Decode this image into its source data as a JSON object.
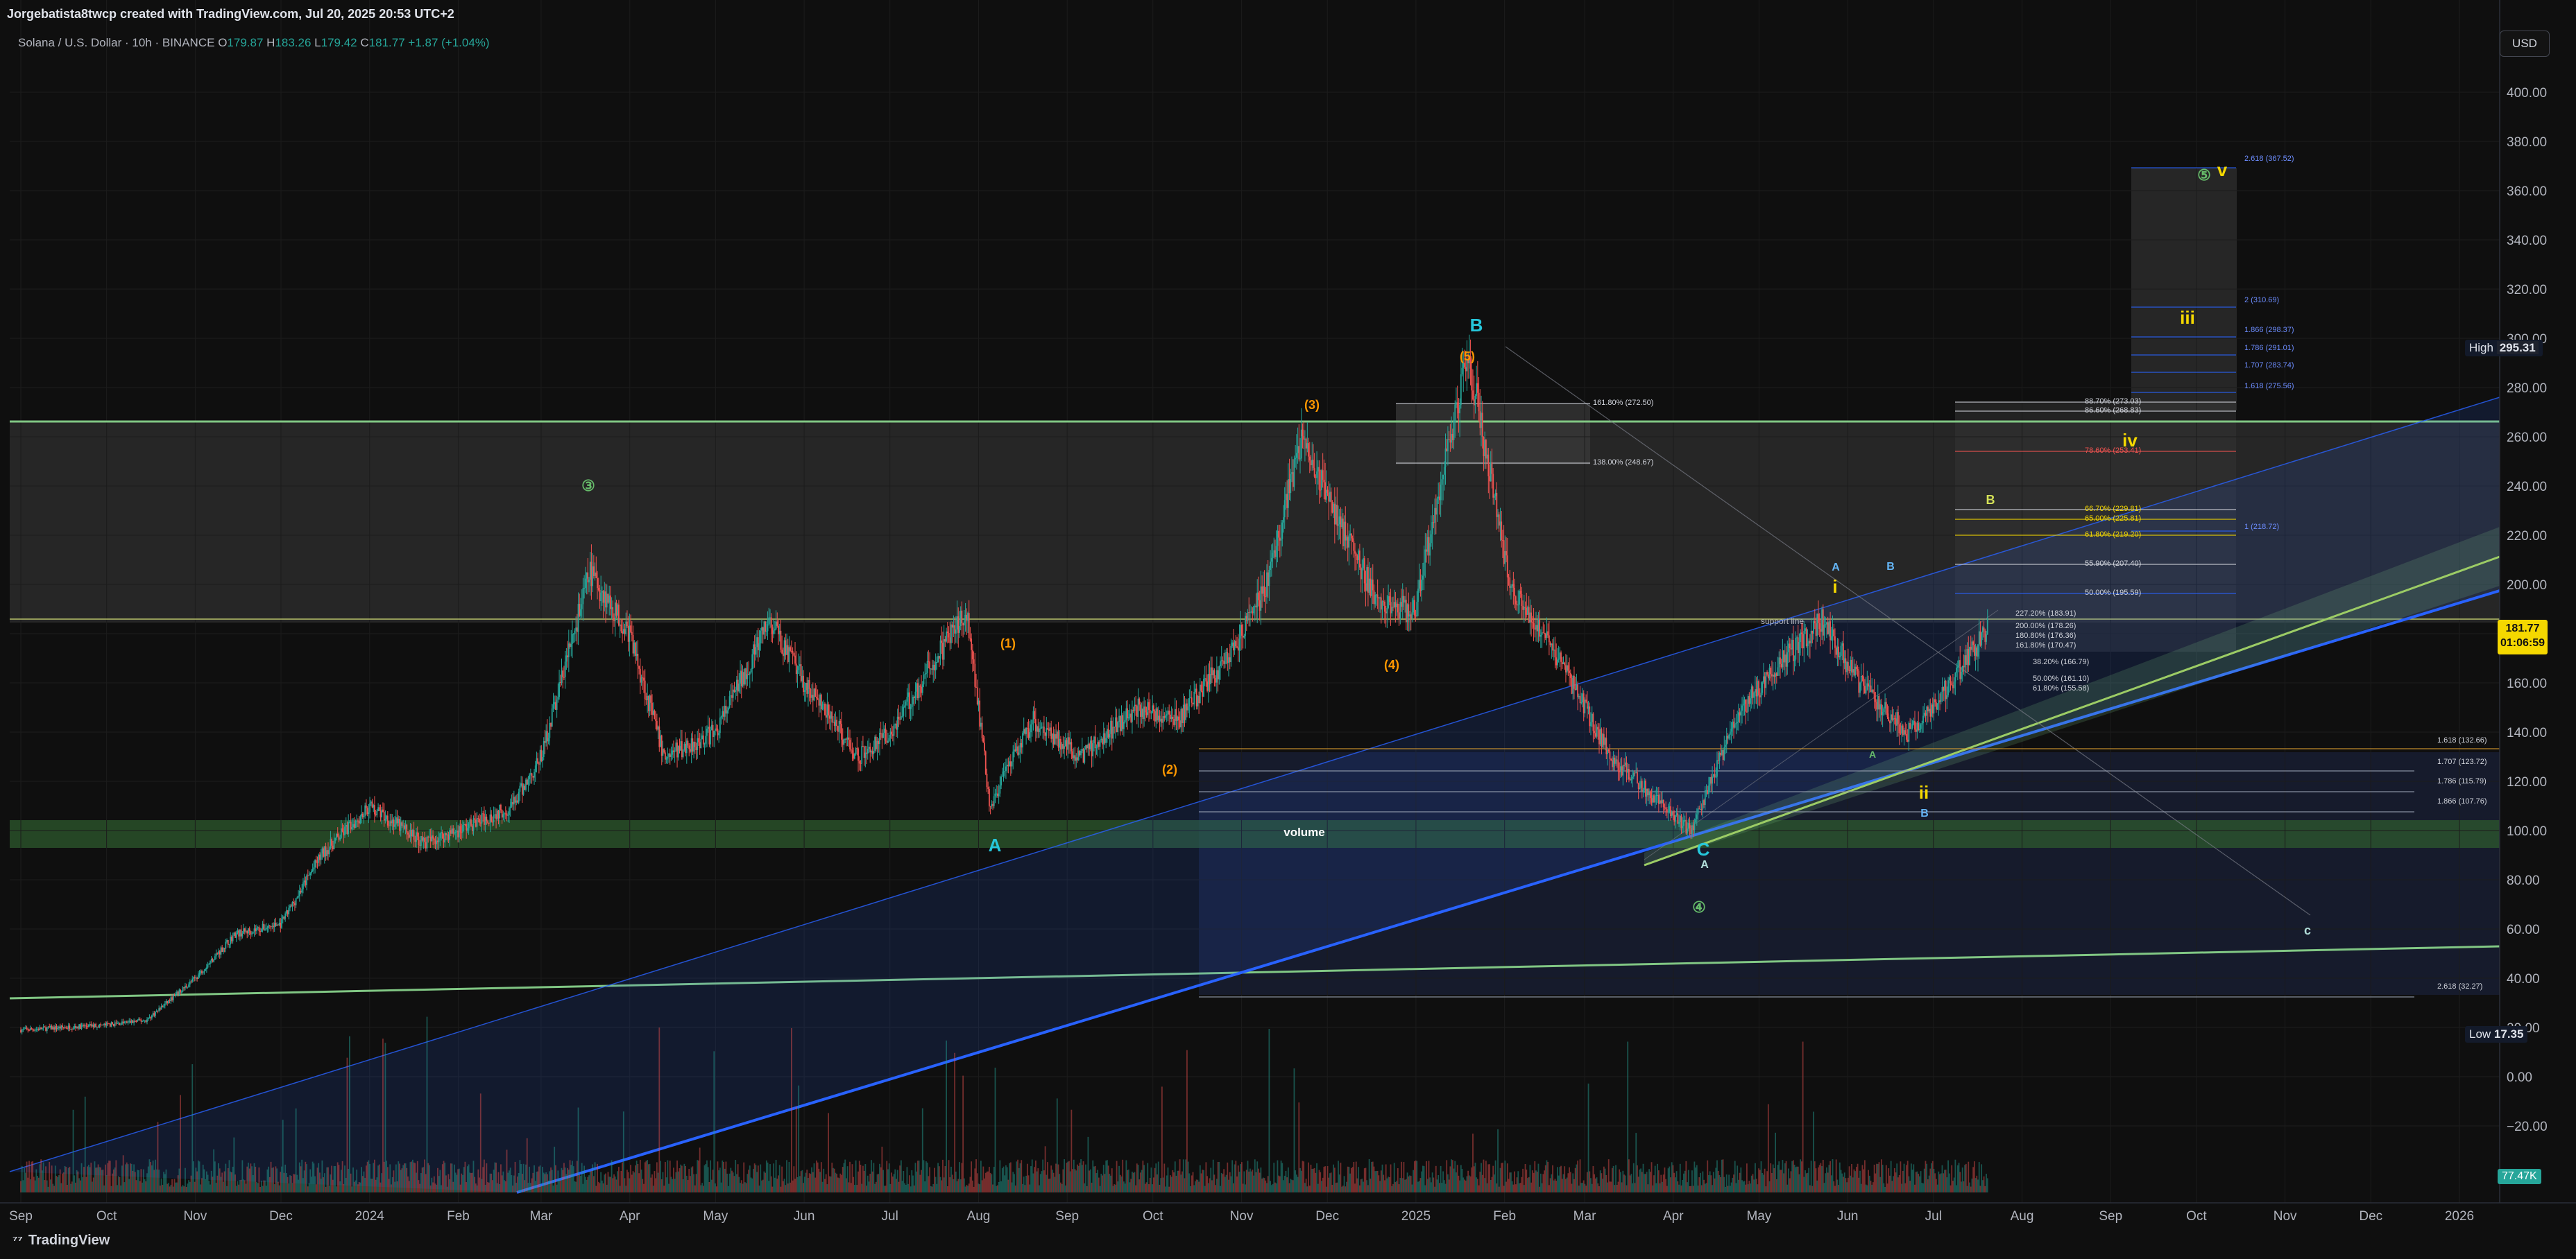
{
  "header": {
    "attribution": "Jorgebatista8twcp created with TradingView.com, Jul 20, 2025 20:53 UTC+2",
    "symbol_line": "Solana / U.S. Dollar · 10h · BINANCE",
    "open_label": "O",
    "open": "179.87",
    "high_label": "H",
    "high": "183.26",
    "low_label": "L",
    "low": "179.42",
    "close_label": "C",
    "close": "181.77",
    "change": "+1.87 (+1.04%)",
    "currency_button": "USD"
  },
  "price_tags": {
    "high_label": "High",
    "high_value": "295.31",
    "low_label": "Low",
    "low_value": "17.35",
    "last_price": "181.77",
    "countdown": "01:06:59",
    "volume_value": "77.47K"
  },
  "footer": {
    "brand": "TradingView"
  },
  "colors": {
    "up": "#26a69a",
    "down": "#ef5350",
    "channel_blue": "#2962ff",
    "channel_green": "#81c784",
    "fib_yellow": "#f5d800",
    "wave_orange": "#ff9800",
    "wave_cyan": "#26c6da"
  },
  "chart_data": {
    "type": "line",
    "title": "Solana / U.S. Dollar · 10h · BINANCE",
    "ylim": [
      -40,
      420
    ],
    "y_ticks": [
      400,
      380,
      360,
      340,
      320,
      300,
      280,
      260,
      240,
      220,
      200,
      180,
      160,
      140,
      120,
      100,
      80,
      60,
      40,
      20,
      "0.00",
      "−20.00"
    ],
    "x_ticks": [
      "Sep",
      "Oct",
      "Nov",
      "Dec",
      "2024",
      "Feb",
      "Mar",
      "Apr",
      "May",
      "Jun",
      "Jul",
      "Aug",
      "Sep",
      "Oct",
      "Nov",
      "Dec",
      "2025",
      "Feb",
      "Mar",
      "Apr",
      "May",
      "Jun",
      "Jul",
      "Aug",
      "Sep",
      "Oct",
      "Nov",
      "Dec",
      "2026"
    ],
    "x_dates": [
      "2023-09-01",
      "2023-10-01",
      "2023-11-01",
      "2023-12-01",
      "2024-01-01",
      "2024-02-01",
      "2024-03-01",
      "2024-04-01",
      "2024-05-01",
      "2024-06-01",
      "2024-07-01",
      "2024-08-01",
      "2024-09-01",
      "2024-10-01",
      "2024-11-01",
      "2024-12-01",
      "2025-01-01",
      "2025-02-01",
      "2025-03-01",
      "2025-04-01",
      "2025-05-01",
      "2025-06-01",
      "2025-07-01",
      "2025-08-01",
      "2025-09-01",
      "2025-10-01",
      "2025-11-01",
      "2025-12-01",
      "2026-01-01"
    ],
    "series": [
      {
        "x": [
          "2023-09-01",
          "2023-10-01",
          "2023-10-15",
          "2023-11-01",
          "2023-11-15",
          "2023-12-01",
          "2023-12-15",
          "2024-01-01",
          "2024-01-20",
          "2024-02-01",
          "2024-02-20",
          "2024-03-01",
          "2024-03-18",
          "2024-04-01",
          "2024-04-13",
          "2024-05-01",
          "2024-05-20",
          "2024-06-01",
          "2024-06-20",
          "2024-07-01",
          "2024-07-28",
          "2024-08-05",
          "2024-08-20",
          "2024-09-06",
          "2024-09-25",
          "2024-10-10",
          "2024-10-30",
          "2024-11-10",
          "2024-11-22",
          "2024-12-05",
          "2024-12-20",
          "2025-01-01",
          "2025-01-19",
          "2025-02-03",
          "2025-02-20",
          "2025-03-10",
          "2025-04-07",
          "2025-04-25",
          "2025-05-14",
          "2025-05-23",
          "2025-06-05",
          "2025-06-22",
          "2025-07-01",
          "2025-07-20"
        ],
        "values": [
          19,
          21,
          23,
          40,
          58,
          62,
          90,
          110,
          95,
          100,
          110,
          130,
          205,
          180,
          130,
          140,
          185,
          160,
          130,
          140,
          190,
          110,
          145,
          130,
          150,
          145,
          175,
          200,
          260,
          225,
          190,
          190,
          295,
          200,
          170,
          130,
          100,
          150,
          175,
          185,
          160,
          140,
          150,
          182
        ]
      }
    ],
    "annotations": {
      "elliott": [
        "③",
        "④",
        "⑤",
        "(1)",
        "(2)",
        "(3)",
        "(4)",
        "(5)",
        "A",
        "B",
        "C",
        "i",
        "ii",
        "iii",
        "iv",
        "v"
      ],
      "texts": [
        "volume",
        "support line"
      ],
      "fib_levels": [
        "161.80% (272.50)",
        "138.00% (248.67)",
        "88.70% (273.03)",
        "86.60% (268.83)",
        "78.60% (253.41)",
        "66.70% (229.81)",
        "65.00% (225.81)",
        "61.80% (219.20)",
        "55.90% (207.40)",
        "50.00% (195.59)",
        "227.20% (183.91)",
        "200.00% (178.26)",
        "180.80% (176.36)",
        "161.80% (170.47)",
        "38.20% (166.79)",
        "50.00% (161.10)",
        "61.80% (155.58)",
        "1.618 (132.66)",
        "1.707 (123.72)",
        "1.786 (115.79)",
        "1.866 (107.76)",
        "2.618 (32.27)",
        "2.618 (367.52)",
        "2 (310.69)",
        "1.866 (298.37)",
        "1.786 (291.01)",
        "1.707 (283.74)",
        "1.618 (275.56)",
        "1 (218.72)"
      ]
    }
  }
}
